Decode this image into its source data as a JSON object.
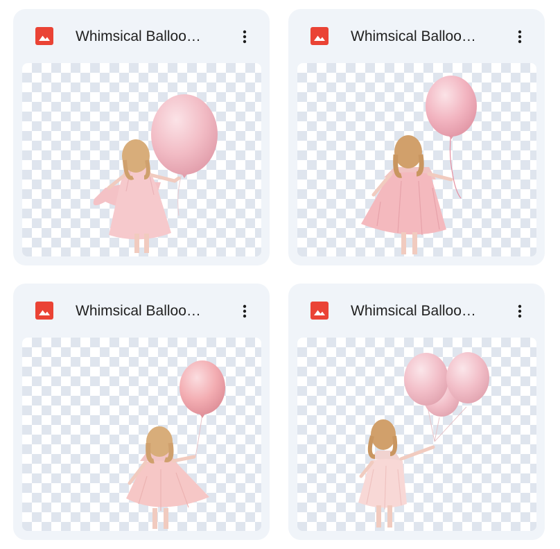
{
  "files": [
    {
      "title": "Whimsical Balloo…",
      "type_icon": "image-file-icon",
      "menu_icon": "more-vert-icon"
    },
    {
      "title": "Whimsical Balloo…",
      "type_icon": "image-file-icon",
      "menu_icon": "more-vert-icon"
    },
    {
      "title": "Whimsical Balloo…",
      "type_icon": "image-file-icon",
      "menu_icon": "more-vert-icon"
    },
    {
      "title": "Whimsical Balloo…",
      "type_icon": "image-file-icon",
      "menu_icon": "more-vert-icon"
    }
  ],
  "colors": {
    "card_background": "#f0f4f9",
    "image_icon": "#ea4335",
    "title_text": "#1f1f1f",
    "balloon": "#f2b9c2",
    "dress": "#f4c2c6",
    "hair": "#d8ad7a",
    "checker": "#dfe5ee"
  }
}
